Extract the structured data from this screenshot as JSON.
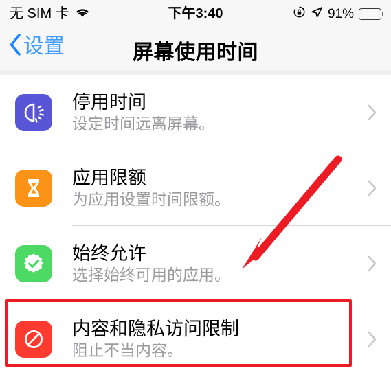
{
  "status_bar": {
    "carrier": "无 SIM 卡",
    "wifi_icon": "wifi-icon",
    "time": "下午3:40",
    "rotation_lock_icon": "rotation-lock-icon",
    "location_icon": "location-arrow-icon",
    "battery_percent": "91%",
    "battery_level": 91
  },
  "nav": {
    "back_label": "设置",
    "back_icon": "chevron-left-icon",
    "title": "屏幕使用时间"
  },
  "list": {
    "rows": [
      {
        "title": "停用时间",
        "subtitle": "设定时间远离屏幕。",
        "icon": "downtime-icon",
        "icon_color": "#5856d6",
        "chevron": "chevron-right-icon"
      },
      {
        "title": "应用限额",
        "subtitle": "为应用设置时间限额。",
        "icon": "hourglass-icon",
        "icon_color": "#fb9416",
        "chevron": "chevron-right-icon"
      },
      {
        "title": "始终允许",
        "subtitle": "选择始终可用的应用。",
        "icon": "checkmark-seal-icon",
        "icon_color": "#4cd964",
        "chevron": "chevron-right-icon"
      },
      {
        "title": "内容和隐私访问限制",
        "subtitle": "阻止不当内容。",
        "icon": "prohibited-icon",
        "icon_color": "#ff3b30",
        "chevron": "chevron-right-icon"
      }
    ]
  },
  "annotations": {
    "highlight_color": "#ed1c24",
    "arrow_color": "#ed1c24",
    "highlight_target": "内容和隐私访问限制",
    "arrow_target": "内容和隐私访问限制"
  }
}
